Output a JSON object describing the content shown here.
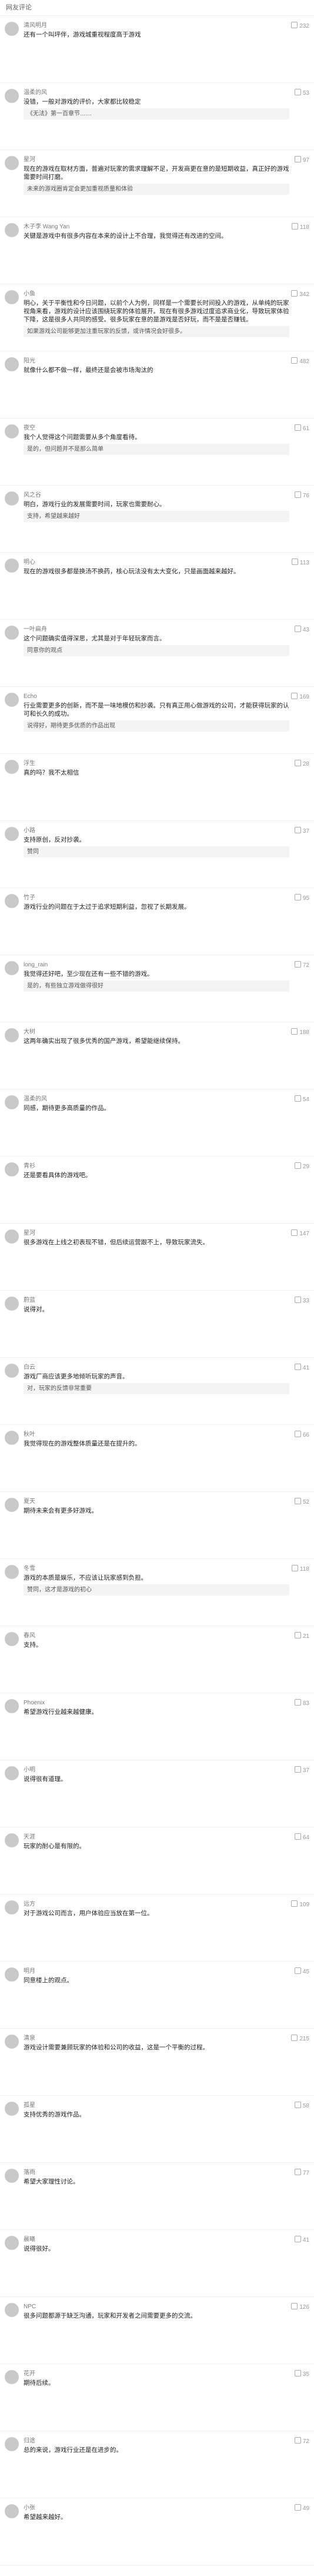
{
  "header": {
    "title": "网友评论"
  },
  "comments": [
    {
      "name": "清风明月",
      "time": "",
      "likes": "232",
      "text": "还有一个叫坪伴，游戏城重视程度高于游戏",
      "reply": ""
    },
    {
      "name": "温柔的风",
      "time": "",
      "likes": "53",
      "text": "没错，一般对游戏的评价，大家都比较稳定",
      "reply": "《无法》第一百章节……"
    },
    {
      "name": "星河",
      "time": "",
      "likes": "97",
      "text": "现在的游戏在取材方面，普遍对玩家的需求理解不足，开发商更在意的是短期收益，真正好的游戏需要时间打磨。",
      "reply": "未来的游戏圈肯定会更加重视质量和体验"
    },
    {
      "name": "木子李 Wang Yan",
      "time": "",
      "likes": "118",
      "text": "关键是游戏中有很多内容在本来的设计上不合理，我觉得还有改进的空间。",
      "reply": ""
    },
    {
      "name": "小鱼",
      "time": "",
      "likes": "342",
      "text": "明心，关于平衡性和今日问题，以前个人为例，同样是一个需要长时间投入的游戏，从单纯的玩家视角来看，游戏的设计应该围绕玩家的体验展开。现在有很多游戏过度追求商业化，导致玩家体验下降，这是很多人共同的感受。很多玩家在意的是游戏是否好玩，而不是是否赚钱。",
      "reply": "如果游戏公司能够更加注重玩家的反馈，或许情况会好很多。"
    },
    {
      "name": "阳光",
      "time": "",
      "likes": "482",
      "text": "就像什么都不做一样，最终还是会被市场淘汰的",
      "reply": ""
    },
    {
      "name": "夜空",
      "time": "",
      "likes": "61",
      "text": "我个人觉得这个问题需要从多个角度看待。",
      "reply": "是的，但问题并不是那么简单"
    },
    {
      "name": "风之谷",
      "time": "",
      "likes": "76",
      "text": "明白，游戏行业的发展需要时间，玩家也需要耐心。",
      "reply": "支持，希望越来越好"
    },
    {
      "name": "明心",
      "time": "",
      "likes": "113",
      "text": "现在的游戏很多都是换汤不换药，核心玩法没有太大变化，只是画面越来越好。",
      "reply": ""
    },
    {
      "name": "一叶扁舟",
      "time": "",
      "likes": "43",
      "text": "这个问题确实值得深思，尤其是对于年轻玩家而言。",
      "reply": "同意你的观点"
    },
    {
      "name": "Echo",
      "time": "",
      "likes": "169",
      "text": "行业需要更多的创新，而不是一味地模仿和抄袭。只有真正用心做游戏的公司，才能获得玩家的认可和长久的成功。",
      "reply": "说得好，期待更多优质的作品出现"
    },
    {
      "name": "浮生",
      "time": "",
      "likes": "28",
      "text": "真的吗？我不太相信",
      "reply": ""
    },
    {
      "name": "小路",
      "time": "",
      "likes": "37",
      "text": "支持原创，反对抄袭。",
      "reply": "赞同"
    },
    {
      "name": "竹子",
      "time": "",
      "likes": "95",
      "text": "游戏行业的问题在于太过于追求短期利益，忽视了长期发展。",
      "reply": ""
    },
    {
      "name": "long_rain",
      "time": "",
      "likes": "72",
      "text": "我觉得还好吧，至少现在还有一些不错的游戏。",
      "reply": "是的，有些独立游戏做得很好"
    },
    {
      "name": "大树",
      "time": "",
      "likes": "188",
      "text": "这两年确实出现了很多优秀的国产游戏，希望能继续保持。",
      "reply": ""
    },
    {
      "name": "温柔的风",
      "time": "",
      "likes": "54",
      "text": "同感，期待更多高质量的作品。",
      "reply": ""
    },
    {
      "name": "青衫",
      "time": "",
      "likes": "29",
      "text": "还是要看具体的游戏吧。",
      "reply": ""
    },
    {
      "name": "星河",
      "time": "",
      "likes": "147",
      "text": "很多游戏在上线之初表现不错，但后续运营跟不上，导致玩家流失。",
      "reply": ""
    },
    {
      "name": "蔚蓝",
      "time": "",
      "likes": "33",
      "text": "说得对。",
      "reply": ""
    },
    {
      "name": "白云",
      "time": "",
      "likes": "41",
      "text": "游戏厂商应该更多地倾听玩家的声音。",
      "reply": "对，玩家的反馈非常重要"
    },
    {
      "name": "秋叶",
      "time": "",
      "likes": "66",
      "text": "我觉得现在的游戏整体质量还是在提升的。",
      "reply": ""
    },
    {
      "name": "夏天",
      "time": "",
      "likes": "52",
      "text": "期待未来会有更多好游戏。",
      "reply": ""
    },
    {
      "name": "冬雪",
      "time": "",
      "likes": "118",
      "text": "游戏的本质是娱乐，不应该让玩家感到负担。",
      "reply": "赞同，这才是游戏的初心"
    },
    {
      "name": "春风",
      "time": "",
      "likes": "21",
      "text": "支持。",
      "reply": ""
    },
    {
      "name": "Phoenix",
      "time": "",
      "likes": "83",
      "text": "希望游戏行业越来越健康。",
      "reply": ""
    },
    {
      "name": "小明",
      "time": "",
      "likes": "37",
      "text": "说得很有道理。",
      "reply": ""
    },
    {
      "name": "天涯",
      "time": "",
      "likes": "64",
      "text": "玩家的耐心是有限的。",
      "reply": ""
    },
    {
      "name": "远方",
      "time": "",
      "likes": "109",
      "text": "对于游戏公司而言，用户体验应当放在第一位。",
      "reply": ""
    },
    {
      "name": "明月",
      "time": "",
      "likes": "45",
      "text": "同意楼上的观点。",
      "reply": ""
    },
    {
      "name": "清泉",
      "time": "",
      "likes": "215",
      "text": "游戏设计需要兼顾玩家的体验和公司的收益，这是一个平衡的过程。",
      "reply": ""
    },
    {
      "name": "孤星",
      "time": "",
      "likes": "58",
      "text": "支持优秀的游戏作品。",
      "reply": ""
    },
    {
      "name": "落雨",
      "time": "",
      "likes": "77",
      "text": "希望大家理性讨论。",
      "reply": ""
    },
    {
      "name": "晨曦",
      "time": "",
      "likes": "41",
      "text": "说得很好。",
      "reply": ""
    },
    {
      "name": "NPC",
      "time": "",
      "likes": "126",
      "text": "很多问题都源于缺乏沟通，玩家和开发者之间需要更多的交流。",
      "reply": ""
    },
    {
      "name": "花开",
      "time": "",
      "likes": "35",
      "text": "期待后续。",
      "reply": ""
    },
    {
      "name": "归途",
      "time": "",
      "likes": "72",
      "text": "总的来说，游戏行业还是在进步的。",
      "reply": ""
    },
    {
      "name": "小张",
      "time": "",
      "likes": "49",
      "text": "希望越来越好。",
      "reply": ""
    }
  ]
}
